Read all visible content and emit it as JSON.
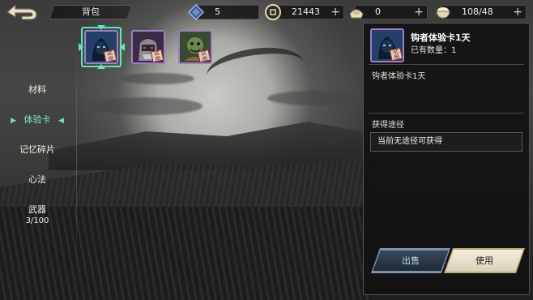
{
  "top_bar": {
    "title": "背包",
    "resources": [
      {
        "name": "diamond",
        "value": "5",
        "has_plus": false
      },
      {
        "name": "coin",
        "value": "21443",
        "has_plus": true
      },
      {
        "name": "ingot",
        "value": "0",
        "has_plus": true
      },
      {
        "name": "stamina",
        "value": "108/48",
        "has_plus": true
      }
    ],
    "plus_glyph": "+"
  },
  "menu": {
    "items": [
      {
        "label": "材料",
        "sub": ""
      },
      {
        "label": "体验卡",
        "sub": ""
      },
      {
        "label": "记忆碎片",
        "sub": ""
      },
      {
        "label": "心法",
        "sub": ""
      },
      {
        "label": "武器",
        "sub": "3/100"
      }
    ],
    "active_index": 1,
    "arrow_left": "▶",
    "arrow_right": "◀"
  },
  "inventory": {
    "cards": [
      {
        "icon": "hooded-ninja-icon",
        "stamp": "试用",
        "selected": true
      },
      {
        "icon": "armored-warrior-icon",
        "stamp": "试用",
        "selected": false
      },
      {
        "icon": "green-monk-icon",
        "stamp": "试用",
        "selected": false
      }
    ]
  },
  "detail": {
    "title": "钩者体验卡1天",
    "owned_label": "已有数量：1",
    "description": "钩者体验卡1天",
    "source_heading": "获得途径",
    "source_text": "当前无途径可获得",
    "stamp": "试用",
    "sell_label": "出售",
    "use_label": "使用"
  },
  "colors": {
    "accent_teal": "#5ee6c0",
    "rarity_purple": "#9d7fc4",
    "sell_blue": "#b7d8f0"
  }
}
